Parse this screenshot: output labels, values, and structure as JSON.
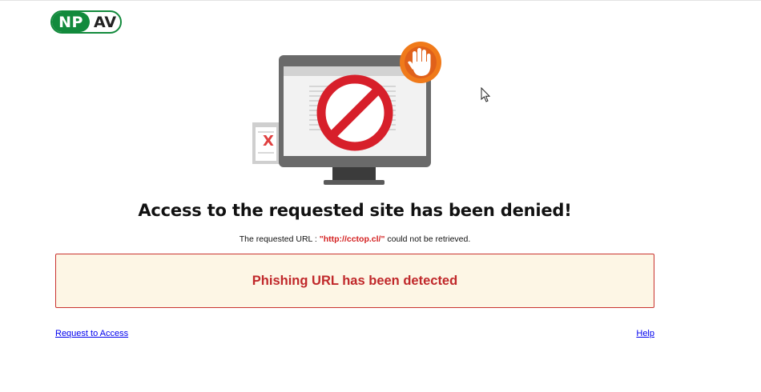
{
  "logo": {
    "left_text": "NP",
    "right_text": "AV"
  },
  "illustration": {
    "icons": [
      "monitor-icon",
      "blocked-sign-icon",
      "stop-hand-icon",
      "x-document-icon"
    ],
    "x_mark": "X",
    "colors": {
      "monitor_frame": "#666666",
      "block_red": "#d71f2a",
      "hand_badge": "#f07a1a",
      "x_red": "#e04040"
    }
  },
  "heading": "Access to the requested site has been denied!",
  "url_line": {
    "prefix": "The requested URL : ",
    "url": "\"http://cctop.cl/\"",
    "suffix": " could not be retrieved."
  },
  "alert": {
    "message": "Phishing URL has been detected",
    "colors": {
      "border": "#c9332f",
      "background": "#fdf6e5",
      "text": "#c0282a"
    }
  },
  "links": {
    "request_access": "Request to Access",
    "help": "Help"
  }
}
